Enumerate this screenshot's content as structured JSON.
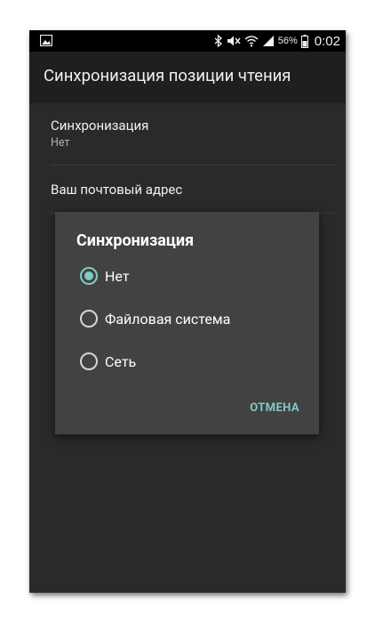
{
  "status_bar": {
    "battery_percent": "56%",
    "time": "0:02",
    "icons": [
      "image-notification-icon",
      "bluetooth-icon",
      "mute-icon",
      "wifi-icon",
      "signal-icon",
      "battery-icon"
    ]
  },
  "toolbar": {
    "title": "Синхронизация позиции чтения"
  },
  "preferences": [
    {
      "title": "Синхронизация",
      "summary": "Нет"
    },
    {
      "title": "Ваш почтовый адрес",
      "summary": ""
    }
  ],
  "dialog": {
    "title": "Синхронизация",
    "options": [
      {
        "label": "Нет",
        "selected": true
      },
      {
        "label": "Файловая система",
        "selected": false
      },
      {
        "label": "Сеть",
        "selected": false
      }
    ],
    "cancel_label": "ОТМЕНА"
  },
  "colors": {
    "accent": "#80cbc4",
    "background": "#2d2d2d",
    "toolbar": "#212121",
    "dialog": "#424242"
  }
}
